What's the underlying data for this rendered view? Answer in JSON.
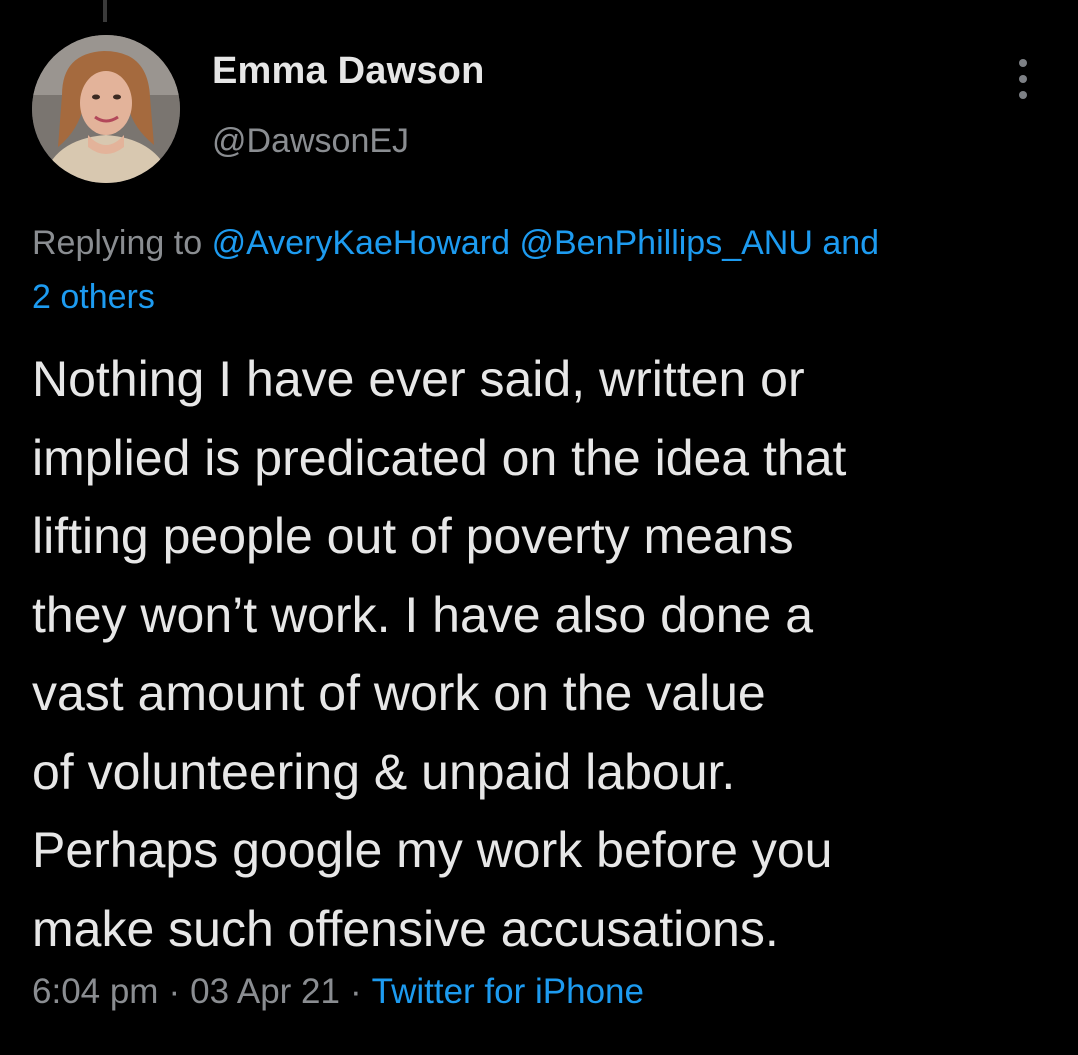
{
  "author": {
    "name": "Emma Dawson",
    "handle": "@DawsonEJ"
  },
  "reply": {
    "prefix": "Replying to",
    "mentions": [
      "@AveryKaeHoward",
      "@BenPhillips_ANU"
    ],
    "joiner": "and",
    "others": "2 others"
  },
  "tweet": {
    "lines": [
      "Nothing I have ever said, written or",
      "implied is predicated on the idea that",
      "lifting people out of poverty means",
      "they won’t work. I have also done a",
      "vast amount of work on the value",
      "of volunteering & unpaid labour.",
      "Perhaps google my work before you",
      "make such offensive accusations."
    ]
  },
  "meta": {
    "time": "6:04 pm",
    "separator": "·",
    "date": "03 Apr 21",
    "source": "Twitter for iPhone"
  },
  "icons": {
    "more": "more-vertical-icon",
    "avatar": "profile-photo"
  },
  "colors": {
    "background": "#000000",
    "text": "#e7e7e7",
    "secondary": "#8a8d91",
    "link": "#1d9bf0"
  }
}
